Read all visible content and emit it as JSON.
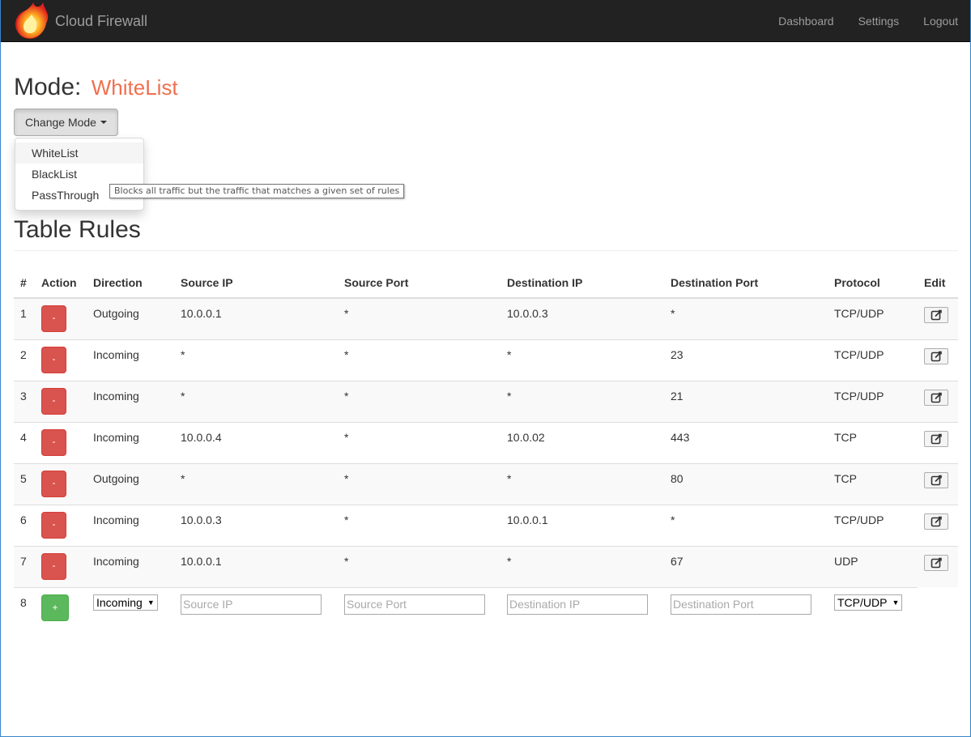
{
  "navbar": {
    "brand": "Cloud Firewall",
    "links": [
      "Dashboard",
      "Settings",
      "Logout"
    ]
  },
  "mode": {
    "label": "Mode:",
    "value": "WhiteList",
    "change_button": "Change Mode",
    "options": [
      "WhiteList",
      "BlackList",
      "PassThrough"
    ],
    "tooltip": "Blocks all traffic but the traffic that matches a given set of rules"
  },
  "section_title": "Table Rules",
  "table": {
    "headers": [
      "#",
      "Action",
      "Direction",
      "Source IP",
      "Source Port",
      "Destination IP",
      "Destination Port",
      "Protocol",
      "Edit"
    ],
    "delete_label": "-",
    "rows": [
      {
        "num": "1",
        "direction": "Outgoing",
        "source_ip": "10.0.0.1",
        "source_port": "*",
        "dest_ip": "10.0.0.3",
        "dest_port": "*",
        "protocol": "TCP/UDP"
      },
      {
        "num": "2",
        "direction": "Incoming",
        "source_ip": "*",
        "source_port": "*",
        "dest_ip": "*",
        "dest_port": "23",
        "protocol": "TCP/UDP"
      },
      {
        "num": "3",
        "direction": "Incoming",
        "source_ip": "*",
        "source_port": "*",
        "dest_ip": "*",
        "dest_port": "21",
        "protocol": "TCP/UDP"
      },
      {
        "num": "4",
        "direction": "Incoming",
        "source_ip": "10.0.0.4",
        "source_port": "*",
        "dest_ip": "10.0.02",
        "dest_port": "443",
        "protocol": "TCP"
      },
      {
        "num": "5",
        "direction": "Outgoing",
        "source_ip": "*",
        "source_port": "*",
        "dest_ip": "*",
        "dest_port": "80",
        "protocol": "TCP"
      },
      {
        "num": "6",
        "direction": "Incoming",
        "source_ip": "10.0.0.3",
        "source_port": "*",
        "dest_ip": "10.0.0.1",
        "dest_port": "*",
        "protocol": "TCP/UDP"
      },
      {
        "num": "7",
        "direction": "Incoming",
        "source_ip": "10.0.0.1",
        "source_port": "*",
        "dest_ip": "*",
        "dest_port": "67",
        "protocol": "UDP"
      }
    ],
    "new_row": {
      "num": "8",
      "add_label": "+",
      "direction_value": "Incoming",
      "source_ip_placeholder": "Source IP",
      "source_port_placeholder": "Source Port",
      "dest_ip_placeholder": "Destination IP",
      "dest_port_placeholder": "Destination Port",
      "protocol_value": "TCP/UDP"
    }
  },
  "colors": {
    "navbar_bg": "#222222",
    "accent_mode": "#f0704f",
    "delete_button": "#d9534f",
    "add_button": "#5cb85c"
  },
  "icons": {
    "brand": "fire-logo-icon",
    "edit": "edit-square-icon",
    "caret": "caret-down-icon",
    "select_arrow": "select-arrow-icon"
  }
}
